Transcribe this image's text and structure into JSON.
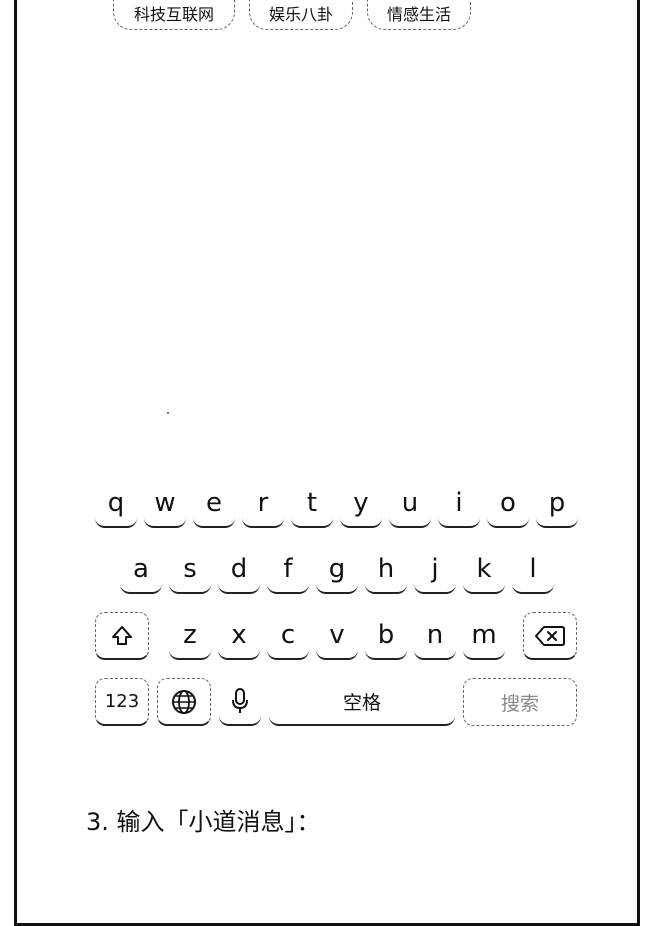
{
  "chips": [
    "科技互联网",
    "娱乐八卦",
    "情感生活"
  ],
  "keyboard": {
    "row1": [
      "q",
      "w",
      "e",
      "r",
      "t",
      "y",
      "u",
      "i",
      "o",
      "p"
    ],
    "row2": [
      "a",
      "s",
      "d",
      "f",
      "g",
      "h",
      "j",
      "k",
      "l"
    ],
    "row3": [
      "z",
      "x",
      "c",
      "v",
      "b",
      "n",
      "m"
    ],
    "numbers_label": "123",
    "space_label": "空格",
    "search_label": "搜索",
    "icons": {
      "shift": "shift-icon",
      "backspace": "backspace-icon",
      "globe": "globe-icon",
      "mic": "microphone-icon"
    }
  },
  "caption": "3. 输入「小道消息」："
}
